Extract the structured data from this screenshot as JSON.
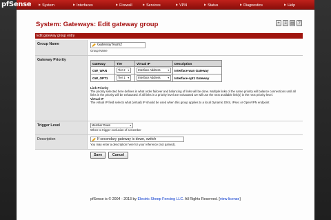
{
  "logo": {
    "prefix": "pf",
    "suffix": "Sense"
  },
  "nav": [
    {
      "label": "System"
    },
    {
      "label": "Interfaces"
    },
    {
      "label": "Firewall"
    },
    {
      "label": "Services"
    },
    {
      "label": "VPN"
    },
    {
      "label": "Status"
    },
    {
      "label": "Diagnostics"
    },
    {
      "label": "Help"
    }
  ],
  "page_title": "System: Gateways: Edit gateway group",
  "title_icons": [
    "plus-icon",
    "log-icon",
    "queue-icon",
    "help-icon"
  ],
  "section_header": "Edit gateway group entry",
  "group_name": {
    "label": "Group Name",
    "value": "GatewayTeam2",
    "help": "Group Name"
  },
  "gateway_priority": {
    "label": "Gateway Priority",
    "columns": [
      "Gateway",
      "Tier",
      "Virtual IP",
      "Description"
    ],
    "rows": [
      {
        "gateway": "GW_WAN",
        "tier": "Tier 2",
        "vip": "Interface Address",
        "description": "Interface wan Gateway"
      },
      {
        "gateway": "GW_OPT1",
        "tier": "Tier 1",
        "vip": "Interface Address",
        "description": "Interface opt1 Gateway"
      }
    ],
    "link_priority_title": "Link Priority",
    "link_priority_text": "The priority selected here defines in what order failover and balancing of links will be done. Multiple links of the same priority will balance connections until all links in the priority will be exhausted. If all links in a priority level are exhausted we will use the next available link(s) in the next priority level.",
    "vip_title": "Virtual IP",
    "vip_text": "The virtual IP field selects what (virtual) IP should be used when this group applies to a local Dynamic DNS, IPsec or OpenVPN endpoint"
  },
  "trigger_level": {
    "label": "Trigger Level",
    "value": "Member Down",
    "help": "When to trigger exclusion of a member"
  },
  "description": {
    "label": "Description",
    "value": "If secondary gateway is down, switch",
    "help": "You may enter a description here for your reference (not parsed)."
  },
  "buttons": {
    "save": "Save",
    "cancel": "Cancel"
  },
  "footer": {
    "prefix": "pfSense",
    "middle": " is © 2004 - 2013 by ",
    "company": "Electric Sheep Fencing LLC",
    "suffix": ". All Rights Reserved. [",
    "license": "view license",
    "end": "]"
  },
  "colors": {
    "brand_red": "#a0150f",
    "link_blue": "#0033cc"
  }
}
